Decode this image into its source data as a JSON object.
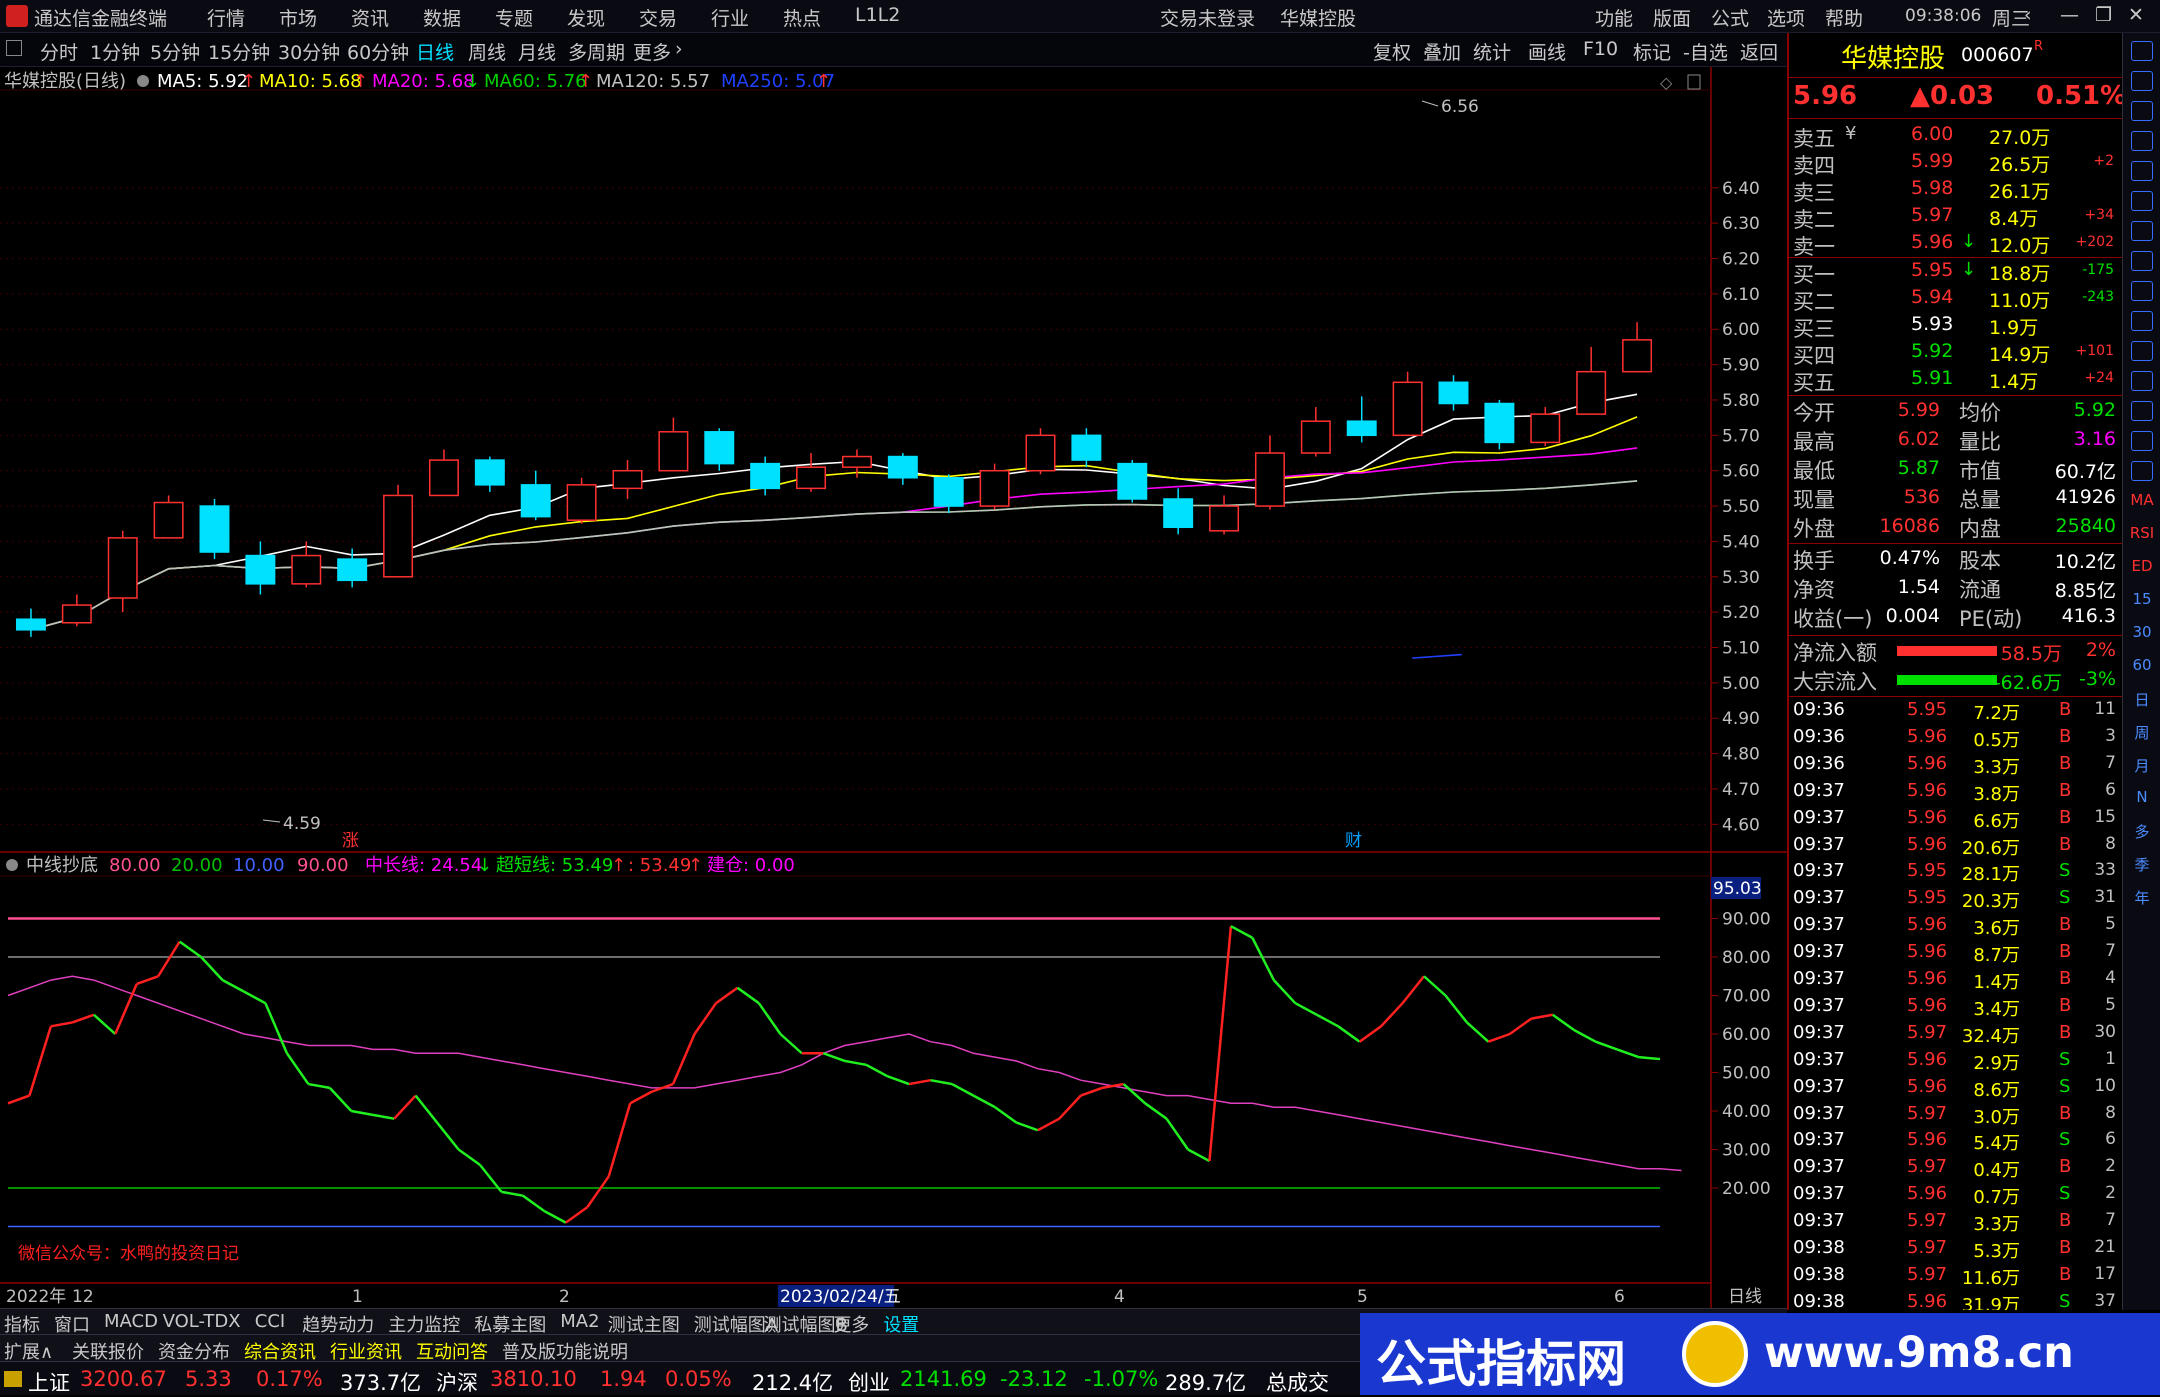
{
  "menu": {
    "app_title": "通达信金融终端",
    "items": [
      "行情",
      "市场",
      "资讯",
      "数据",
      "专题",
      "发现",
      "交易",
      "行业",
      "热点",
      "L1L2"
    ],
    "login": "交易未登录",
    "stock": "华媒控股",
    "right": [
      "功能",
      "版面",
      "公式",
      "选项",
      "帮助"
    ],
    "time": "09:38:06",
    "weekday": "周三"
  },
  "toolbar": {
    "periods": [
      "分时",
      "1分钟",
      "5分钟",
      "15分钟",
      "30分钟",
      "60分钟",
      "日线",
      "周线",
      "月线",
      "多周期",
      "更多"
    ],
    "more_arrow": "›",
    "actions": [
      "复权",
      "叠加",
      "统计",
      "画线",
      "F10",
      "标记",
      "-自选",
      "返回"
    ]
  },
  "chart_header": {
    "name": "华媒控股(日线)",
    "ma5": "MA5: 5.92",
    "ma10": "MA10: 5.68",
    "ma20": "MA20: 5.68",
    "ma60": "MA60: 5.76",
    "ma120": "MA120: 5.57",
    "ma250": "MA250: 5.07",
    "ma5_arrow": "↑",
    "ma10_arrow": "↑",
    "ma20_arrow": "↓",
    "ma60_arrow": "↑",
    "ma250_arrow": "↑"
  },
  "annotations": {
    "high": "6.56",
    "low": "4.59",
    "zhang": "涨",
    "cai": "财"
  },
  "indicator_header": {
    "name": "中线抄底",
    "p1": "80.00",
    "p2": "20.00",
    "p3": "10.00",
    "p4": "90.00",
    "mid": "中长线: 24.54",
    "mid_arrow": "↓",
    "short": "超短线: 53.49",
    "short_arrow": "↑",
    "val": ": 53.49",
    "val_arrow": "↑",
    "build": "建仓: 0.00",
    "watermark": "微信公众号：水鸭的投资日记",
    "yb": "95.03"
  },
  "time_axis": {
    "labels": [
      "2022年",
      "12",
      "1",
      "2",
      "2023/02/24/五",
      "4",
      "5",
      "6"
    ],
    "period": "日线"
  },
  "colors": {
    "up": "#ff3030",
    "down": "#00e0ff",
    "ma5": "#ffffff",
    "ma10": "#ffff00",
    "ma20": "#ff00ff",
    "ma60": "#00d000",
    "ma120": "#c0c0c0",
    "ma250": "#2040ff",
    "grid": "#8b0000"
  },
  "chart_data": [
    {
      "type": "candlestick",
      "title": "华媒控股(日线)",
      "y_ticks": [
        "6.40",
        "6.30",
        "6.20",
        "6.10",
        "6.00",
        "5.90",
        "5.80",
        "5.70",
        "5.60",
        "5.50",
        "5.40",
        "5.30",
        "5.20",
        "5.10",
        "5.00",
        "4.90",
        "4.80",
        "4.70",
        "4.60"
      ],
      "ylim": [
        4.55,
        6.62
      ],
      "high": 6.56,
      "low": 4.59,
      "candles": [
        [
          5.18,
          5.15,
          5.21,
          5.13
        ],
        [
          5.17,
          5.22,
          5.25,
          5.16
        ],
        [
          5.24,
          5.41,
          5.43,
          5.2
        ],
        [
          5.41,
          5.51,
          5.53,
          5.41
        ],
        [
          5.5,
          5.37,
          5.52,
          5.35
        ],
        [
          5.36,
          5.28,
          5.4,
          5.25
        ],
        [
          5.28,
          5.36,
          5.4,
          5.27
        ],
        [
          5.35,
          5.29,
          5.38,
          5.27
        ],
        [
          5.3,
          5.53,
          5.56,
          5.3
        ],
        [
          5.53,
          5.63,
          5.66,
          5.53
        ],
        [
          5.63,
          5.56,
          5.64,
          5.54
        ],
        [
          5.56,
          5.47,
          5.6,
          5.46
        ],
        [
          5.46,
          5.56,
          5.58,
          5.45
        ],
        [
          5.55,
          5.6,
          5.63,
          5.52
        ],
        [
          5.6,
          5.71,
          5.75,
          5.6
        ],
        [
          5.71,
          5.62,
          5.72,
          5.6
        ],
        [
          5.62,
          5.55,
          5.64,
          5.53
        ],
        [
          5.55,
          5.61,
          5.65,
          5.54
        ],
        [
          5.61,
          5.64,
          5.66,
          5.58
        ],
        [
          5.64,
          5.58,
          5.65,
          5.56
        ],
        [
          5.58,
          5.5,
          5.59,
          5.48
        ],
        [
          5.5,
          5.6,
          5.62,
          5.49
        ],
        [
          5.6,
          5.7,
          5.72,
          5.59
        ],
        [
          5.7,
          5.63,
          5.72,
          5.61
        ],
        [
          5.62,
          5.52,
          5.63,
          5.51
        ],
        [
          5.52,
          5.44,
          5.55,
          5.42
        ],
        [
          5.43,
          5.5,
          5.53,
          5.42
        ],
        [
          5.5,
          5.65,
          5.7,
          5.49
        ],
        [
          5.65,
          5.74,
          5.78,
          5.64
        ],
        [
          5.74,
          5.7,
          5.81,
          5.68
        ],
        [
          5.7,
          5.85,
          5.88,
          5.7
        ],
        [
          5.85,
          5.79,
          5.87,
          5.77
        ],
        [
          5.79,
          5.68,
          5.8,
          5.66
        ],
        [
          5.68,
          5.76,
          5.78,
          5.67
        ],
        [
          5.76,
          5.88,
          5.95,
          5.76
        ],
        [
          5.88,
          5.97,
          6.02,
          5.88
        ]
      ],
      "ma250_start": [
        0.85,
        5.07
      ],
      "ma250_end": [
        0.88,
        5.08
      ]
    },
    {
      "type": "line",
      "title": "中线抄底",
      "y_ticks": [
        "90.00",
        "80.00",
        "70.00",
        "60.00",
        "50.00",
        "40.00",
        "30.00",
        "20.00"
      ],
      "ylim": [
        0,
        100
      ],
      "levels": [
        {
          "value": 90,
          "color": "#ff5090"
        },
        {
          "value": 80,
          "color": "#909090"
        },
        {
          "value": 20,
          "color": "#00c000"
        },
        {
          "value": 10,
          "color": "#4060ff"
        }
      ],
      "series": [
        {
          "name": "中长线",
          "values": [
            70,
            72,
            74,
            75,
            74,
            72,
            70,
            68,
            66,
            64,
            62,
            60,
            59,
            58,
            57,
            57,
            57,
            56,
            56,
            55,
            55,
            55,
            54,
            53,
            52,
            51,
            50,
            49,
            48,
            47,
            46,
            46,
            46,
            47,
            48,
            49,
            50,
            52,
            55,
            57,
            58,
            59,
            60,
            58,
            57,
            55,
            54,
            53,
            51,
            50,
            48,
            47,
            46,
            45,
            44,
            44,
            43,
            42,
            42,
            41,
            41,
            40,
            39,
            38,
            37,
            36,
            35,
            34,
            33,
            32,
            31,
            30,
            29,
            28,
            27,
            26,
            25,
            25,
            24.54
          ]
        },
        {
          "name": "超短线",
          "values": [
            42,
            44,
            62,
            63,
            65,
            60,
            73,
            75,
            84,
            80,
            74,
            71,
            68,
            55,
            47,
            46,
            40,
            39,
            38,
            44,
            37,
            30,
            26,
            19,
            18,
            14,
            11,
            15,
            23,
            42,
            45,
            47,
            60,
            68,
            72,
            68,
            60,
            55,
            55,
            53,
            52,
            49,
            47,
            48,
            47,
            44,
            41,
            37,
            35,
            38,
            44,
            46,
            47,
            42,
            38,
            30,
            27,
            88,
            85,
            74,
            68,
            65,
            62,
            58,
            62,
            68,
            75,
            70,
            63,
            58,
            60,
            64,
            65,
            61,
            58,
            56,
            54,
            53.49
          ]
        }
      ]
    }
  ],
  "quote": {
    "name": "华媒控股",
    "code": "000607",
    "r": "R",
    "price": "5.96",
    "change": "▲0.03",
    "pct": "0.51%",
    "sells": [
      {
        "label": "卖五",
        "flag": "¥",
        "price": "6.00",
        "vol": "27.0万",
        "chg": ""
      },
      {
        "label": "卖四",
        "flag": "",
        "price": "5.99",
        "vol": "26.5万",
        "chg": "+2"
      },
      {
        "label": "卖三",
        "flag": "",
        "price": "5.98",
        "vol": "26.1万",
        "chg": ""
      },
      {
        "label": "卖二",
        "flag": "",
        "price": "5.97",
        "vol": "8.4万",
        "chg": "+34"
      },
      {
        "label": "卖一",
        "flag": "",
        "price": "5.96",
        "vol": "12.0万",
        "chg": "+202",
        "arrow": "↓"
      }
    ],
    "buys": [
      {
        "label": "买一",
        "price": "5.95",
        "vol": "18.8万",
        "chg": "-175",
        "arrow": "↓"
      },
      {
        "label": "买二",
        "price": "5.94",
        "vol": "11.0万",
        "chg": "-243"
      },
      {
        "label": "买三",
        "price": "5.93",
        "vol": "1.9万",
        "chg": ""
      },
      {
        "label": "买四",
        "price": "5.92",
        "vol": "14.9万",
        "chg": "+101"
      },
      {
        "label": "买五",
        "price": "5.91",
        "vol": "1.4万",
        "chg": "+24"
      }
    ],
    "stats": [
      [
        "今开",
        "5.99",
        "均价",
        "5.92"
      ],
      [
        "最高",
        "6.02",
        "量比",
        "3.16"
      ],
      [
        "最低",
        "5.87",
        "市值",
        "60.7亿"
      ],
      [
        "现量",
        "536",
        "总量",
        "41926"
      ],
      [
        "外盘",
        "16086",
        "内盘",
        "25840"
      ]
    ],
    "stats2": [
      [
        "换手",
        "0.47%",
        "股本",
        "10.2亿"
      ],
      [
        "净资",
        "1.54",
        "流通",
        "8.85亿"
      ],
      [
        "收益(一)",
        "0.004",
        "PE(动)",
        "416.3"
      ]
    ],
    "flows": [
      {
        "label": "净流入额",
        "value": "58.5万",
        "pct": "2%"
      },
      {
        "label": "大宗流入",
        "value": "-62.6万",
        "pct": "-3%"
      }
    ],
    "ticks": [
      [
        "09:36",
        "5.95",
        "7.2万",
        "B",
        "11"
      ],
      [
        "09:36",
        "5.96",
        "0.5万",
        "B",
        "3"
      ],
      [
        "09:36",
        "5.96",
        "3.3万",
        "B",
        "7"
      ],
      [
        "09:37",
        "5.96",
        "3.8万",
        "B",
        "6"
      ],
      [
        "09:37",
        "5.96",
        "6.6万",
        "B",
        "15"
      ],
      [
        "09:37",
        "5.96",
        "20.6万",
        "B",
        "8"
      ],
      [
        "09:37",
        "5.95",
        "28.1万",
        "S",
        "33"
      ],
      [
        "09:37",
        "5.95",
        "20.3万",
        "S",
        "31"
      ],
      [
        "09:37",
        "5.96",
        "3.6万",
        "B",
        "5"
      ],
      [
        "09:37",
        "5.96",
        "8.7万",
        "B",
        "7"
      ],
      [
        "09:37",
        "5.96",
        "1.4万",
        "B",
        "4"
      ],
      [
        "09:37",
        "5.96",
        "3.4万",
        "B",
        "5"
      ],
      [
        "09:37",
        "5.97",
        "32.4万",
        "B",
        "30"
      ],
      [
        "09:37",
        "5.96",
        "2.9万",
        "S",
        "1"
      ],
      [
        "09:37",
        "5.96",
        "8.6万",
        "S",
        "10"
      ],
      [
        "09:37",
        "5.97",
        "3.0万",
        "B",
        "8"
      ],
      [
        "09:37",
        "5.96",
        "5.4万",
        "S",
        "6"
      ],
      [
        "09:37",
        "5.97",
        "0.4万",
        "B",
        "2"
      ],
      [
        "09:37",
        "5.96",
        "0.7万",
        "S",
        "2"
      ],
      [
        "09:37",
        "5.97",
        "3.3万",
        "B",
        "7"
      ],
      [
        "09:38",
        "5.97",
        "5.3万",
        "B",
        "21"
      ],
      [
        "09:38",
        "5.97",
        "11.6万",
        "B",
        "17"
      ],
      [
        "09:38",
        "5.96",
        "31.9万",
        "S",
        "37"
      ]
    ]
  },
  "side_icons": [
    "MA",
    "RSI",
    "ED",
    "15",
    "30",
    "60",
    "日",
    "周",
    "月",
    "N",
    "多",
    "季",
    "年"
  ],
  "bottom_tabs": [
    "指标",
    "窗口",
    "MACD",
    "VOL-TDX",
    "CCI",
    "趋势动力",
    "主力监控",
    "私募主图",
    "MA2",
    "测试主图",
    "测试幅图A",
    "测试幅图B",
    "更多",
    "设置"
  ],
  "bottom_tabs2": [
    "扩展∧",
    "关联报价",
    "资金分布",
    "综合资讯",
    "行业资讯",
    "互动问答",
    "普及版功能说明"
  ],
  "status": [
    {
      "name": "上证",
      "index": "3200.67",
      "chg": "5.33",
      "pct": "0.17%",
      "amt": "373.7亿"
    },
    {
      "name": "沪深",
      "index": "3810.10",
      "chg": "1.94",
      "pct": "0.05%",
      "amt": "212.4亿"
    },
    {
      "name": "创业",
      "index": "2141.69",
      "chg": "-23.12",
      "pct": "-1.07%",
      "amt": "289.7亿"
    }
  ],
  "status_tail": "总成交",
  "banner": {
    "text": "公式指标网",
    "url": "www.9m8.cn"
  }
}
